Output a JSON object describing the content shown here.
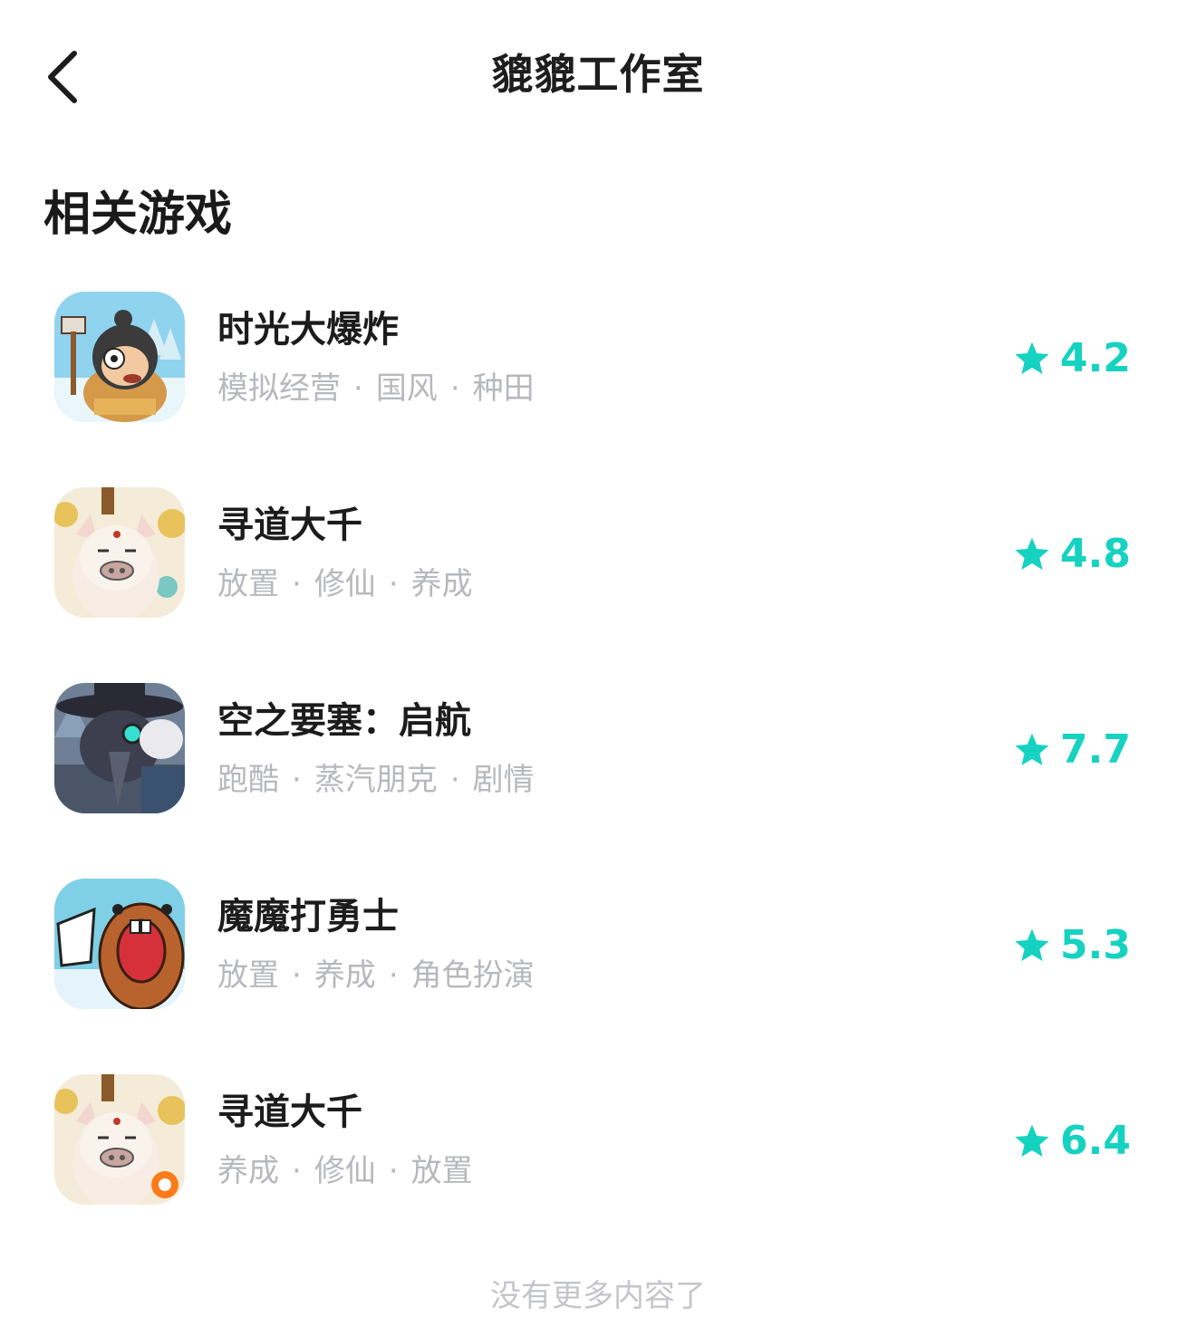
{
  "header": {
    "title": "貔貔工作室",
    "back_icon": "chevron-left-icon"
  },
  "section": {
    "title": "相关游戏"
  },
  "accent_color": "#16d2c0",
  "games": [
    {
      "name": "时光大爆炸",
      "tags": [
        "模拟经营",
        "国风",
        "种田"
      ],
      "rating": "4.2",
      "icon": "caveman-hammer-icon"
    },
    {
      "name": "寻道大千",
      "tags": [
        "放置",
        "修仙",
        "养成"
      ],
      "rating": "4.8",
      "icon": "boar-immortal-icon"
    },
    {
      "name": "空之要塞：启航",
      "tags": [
        "跑酷",
        "蒸汽朋克",
        "剧情"
      ],
      "rating": "7.7",
      "icon": "plague-doctor-icon"
    },
    {
      "name": "魔魔打勇士",
      "tags": [
        "放置",
        "养成",
        "角色扮演"
      ],
      "rating": "5.3",
      "icon": "screaming-beaver-icon"
    },
    {
      "name": "寻道大千",
      "tags": [
        "养成",
        "修仙",
        "放置"
      ],
      "rating": "6.4",
      "icon": "boar-immortal-icon"
    }
  ],
  "footer": {
    "text": "没有更多内容了"
  }
}
